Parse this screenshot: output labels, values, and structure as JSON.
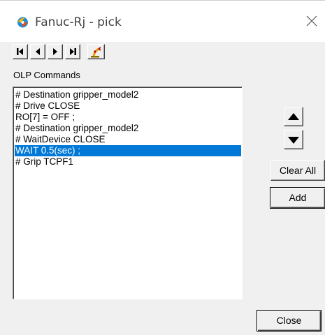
{
  "window": {
    "title": "Fanuc-Rj - pick",
    "close_icon": "close-icon",
    "app_icon": "app-icon"
  },
  "toolbar": {
    "buttons": [
      {
        "name": "first-button",
        "icon": "skip-first-icon"
      },
      {
        "name": "prev-button",
        "icon": "prev-icon"
      },
      {
        "name": "next-button",
        "icon": "next-icon"
      },
      {
        "name": "last-button",
        "icon": "skip-last-icon"
      },
      {
        "name": "robot-button",
        "icon": "robot-arm-icon"
      }
    ]
  },
  "commands": {
    "label": "OLP Commands",
    "items": [
      "# Destination  gripper_model2",
      "# Drive CLOSE",
      "RO[7] = OFF ;",
      "# Destination  gripper_model2",
      "# WaitDevice CLOSE",
      "WAIT 0.5(sec) ;",
      "# Grip  TCPF1"
    ],
    "selected_index": 5
  },
  "side": {
    "up_icon": "up-arrow-icon",
    "down_icon": "down-arrow-icon",
    "clear_all_label": "Clear All",
    "add_label": "Add"
  },
  "footer": {
    "close_label": "Close"
  },
  "colors": {
    "selection": "#0078d7",
    "face": "#f0f0f0"
  }
}
